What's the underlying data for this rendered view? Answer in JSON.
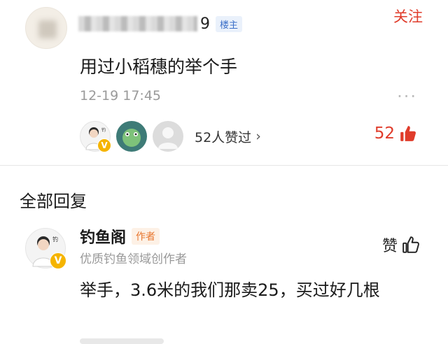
{
  "post": {
    "user_suffix": "9",
    "op_badge": "楼主",
    "follow": "关注",
    "text": "用过小稻穗的举个手",
    "time": "12-19 17:45",
    "more": "···",
    "likes_label": "52人赞过",
    "likes_chevron": "›",
    "like_total": "52",
    "verified_mark": "V"
  },
  "section": {
    "title": "全部回复"
  },
  "reply": {
    "name": "钓鱼阁",
    "author_badge": "作者",
    "subtitle": "优质钓鱼领域创作者",
    "like_label": "赞",
    "text": "举手，3.6米的我们那卖25，买过好几根",
    "verified_mark": "V"
  },
  "colors": {
    "accent": "#e03c2b",
    "op_badge": "#3b6fc8",
    "author_badge": "#e8762f",
    "verified": "#f5b400"
  },
  "icons": {
    "thumb_filled": "thumbs-up-filled-icon",
    "thumb_outline": "thumbs-up-outline-icon",
    "more": "more-dots-icon",
    "chevron": "chevron-right-icon"
  }
}
